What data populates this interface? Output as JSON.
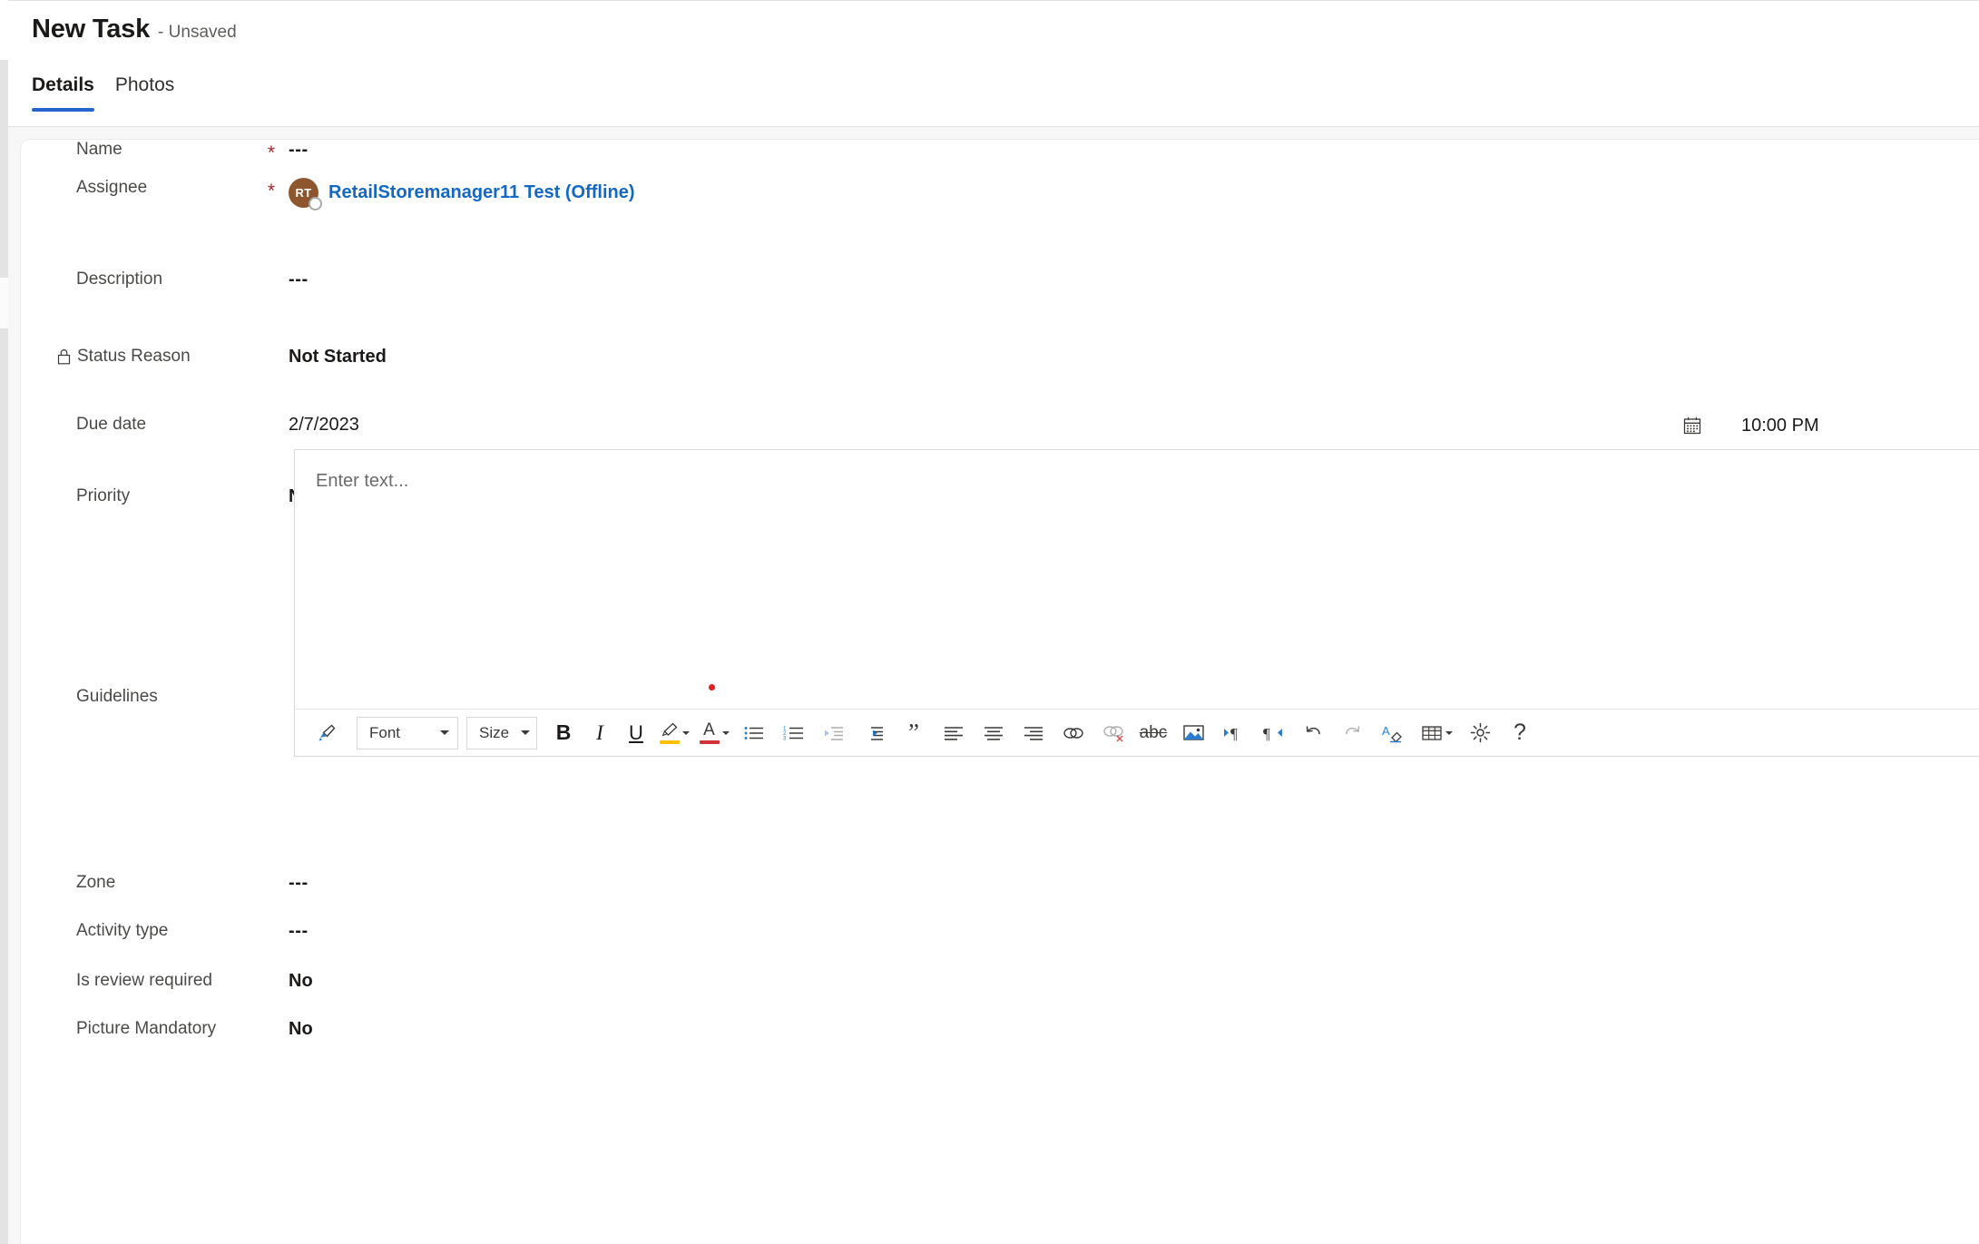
{
  "header": {
    "title": "New Task",
    "subtitle": "- Unsaved",
    "tabs": [
      {
        "label": "Details",
        "active": true
      },
      {
        "label": "Photos",
        "active": false
      }
    ],
    "accent_color": "#2564cf"
  },
  "form": {
    "fields": [
      {
        "label": "Name",
        "required": true,
        "value": "---",
        "style": "dashes"
      },
      {
        "label": "Assignee",
        "required": true,
        "value": "RetailStoremanager11 Test (Offline)",
        "style": "person"
      },
      {
        "label": "Description",
        "required": false,
        "value": "---",
        "style": "dashes"
      },
      {
        "label": "Status Reason",
        "required": false,
        "value": "Not Started",
        "style": "strong",
        "locked": true
      },
      {
        "label": "Due date",
        "required": false,
        "value": "2/7/2023",
        "style": "plain"
      },
      {
        "label": "Priority",
        "required": false,
        "value": "Normal",
        "style": "strong"
      },
      {
        "label": "Guidelines",
        "required": false,
        "value": "",
        "style": "editor"
      },
      {
        "label": "Zone",
        "required": false,
        "value": "---",
        "style": "dashes"
      },
      {
        "label": "Activity type",
        "required": false,
        "value": "---",
        "style": "dashes"
      },
      {
        "label": "Is review required",
        "required": false,
        "value": "No",
        "style": "strong"
      },
      {
        "label": "Picture Mandatory",
        "required": false,
        "value": "No",
        "style": "strong"
      }
    ],
    "required_marker": "*",
    "required_color": "#a4262c"
  },
  "assignee": {
    "initials": "RT",
    "name": "RetailStoremanager11 Test (Offline)",
    "avatar_color": "#8e562e",
    "link_color": "#1268c3",
    "presence": "offline"
  },
  "due_date": {
    "label": "Due date",
    "date": "2/7/2023",
    "time": "10:00 PM",
    "calendar_icon": "calendar-icon"
  },
  "editor": {
    "placeholder": "Enter text...",
    "marker_color": "#e02020",
    "toolbar": {
      "font_label": "Font",
      "size_label": "Size",
      "buttons": [
        {
          "name": "format-painter-icon",
          "label": "Format Painter"
        },
        {
          "name": "bold-icon",
          "label": "B"
        },
        {
          "name": "italic-icon",
          "label": "I"
        },
        {
          "name": "underline-icon",
          "label": "U"
        },
        {
          "name": "highlight-color-icon",
          "label": "Highlight",
          "color": "#ffc000"
        },
        {
          "name": "font-color-icon",
          "label": "A",
          "color": "#d13438"
        },
        {
          "name": "bulleted-list-icon",
          "label": "Bulleted list"
        },
        {
          "name": "numbered-list-icon",
          "label": "Numbered list"
        },
        {
          "name": "decrease-indent-icon",
          "label": "Decrease indent",
          "disabled": true
        },
        {
          "name": "increase-indent-icon",
          "label": "Increase indent"
        },
        {
          "name": "blockquote-icon",
          "label": "Blockquote"
        },
        {
          "name": "align-left-icon",
          "label": "Align left"
        },
        {
          "name": "align-center-icon",
          "label": "Align center"
        },
        {
          "name": "align-right-icon",
          "label": "Align right"
        },
        {
          "name": "insert-link-icon",
          "label": "Insert link"
        },
        {
          "name": "remove-link-icon",
          "label": "Remove link",
          "disabled": true
        },
        {
          "name": "strikethrough-icon",
          "label": "abc"
        },
        {
          "name": "insert-image-icon",
          "label": "Insert image"
        },
        {
          "name": "ltr-direction-icon",
          "label": "Left to right"
        },
        {
          "name": "rtl-direction-icon",
          "label": "Right to left"
        },
        {
          "name": "undo-icon",
          "label": "Undo"
        },
        {
          "name": "redo-icon",
          "label": "Redo",
          "disabled": true
        },
        {
          "name": "clear-formatting-icon",
          "label": "Clear formatting"
        },
        {
          "name": "insert-table-icon",
          "label": "Insert table"
        },
        {
          "name": "editor-settings-icon",
          "label": "Settings"
        },
        {
          "name": "help-icon",
          "label": "Help"
        }
      ]
    }
  }
}
